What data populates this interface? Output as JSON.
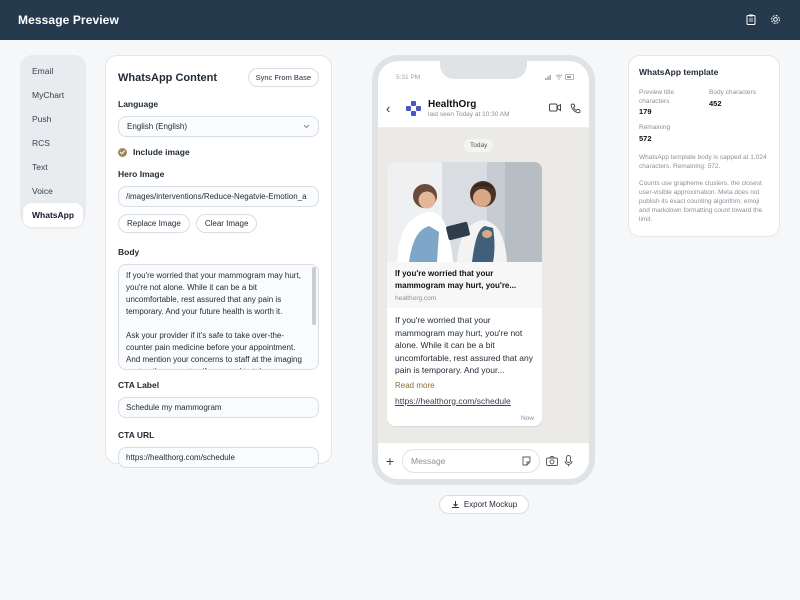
{
  "app": {
    "title": "Message Preview"
  },
  "channels": [
    {
      "label": "Email"
    },
    {
      "label": "MyChart"
    },
    {
      "label": "Push"
    },
    {
      "label": "RCS"
    },
    {
      "label": "Text"
    },
    {
      "label": "Voice"
    },
    {
      "label": "WhatsApp",
      "active": true
    }
  ],
  "content_panel": {
    "title": "WhatsApp Content",
    "sync_label": "Sync From Base",
    "language_label": "Language",
    "language_value": "English (English)",
    "include_image_label": "Include image",
    "hero_label": "Hero Image",
    "hero_value": "/images/interventions/Reduce-Negatvie-Emotion_a",
    "replace_label": "Replace Image",
    "clear_label": "Clear Image",
    "body_label": "Body",
    "body_p1": "If you're worried that your mammogram may hurt, you're not alone. While it can be a bit uncomfortable, rest assured that any pain is temporary. And your future health is worth it.",
    "body_p2": "Ask your provider if it's safe to take over-the-counter pain medicine before your appointment. And mention your concerns to staff at the imaging center; they can stop if you need to take a",
    "cta_label_label": "CTA Label",
    "cta_label_value": "Schedule my mammogram",
    "cta_url_label": "CTA URL",
    "cta_url_value": "https://healthorg.com/schedule"
  },
  "phone": {
    "time": "5:31 PM",
    "contact_name": "HealthOrg",
    "last_seen": "last seen Today at 10:30 AM",
    "date_chip": "Today",
    "link_title": "If you're worried that your mammogram may hurt, you're...",
    "link_domain": "healthorg.com",
    "message": "If you're worried that your mammogram may hurt, you're not alone. While it can be a bit uncomfortable, rest assured that any pain is temporary. And your...",
    "read_more": "Read more",
    "link_url": "https://healthorg.com/schedule",
    "timestamp": "Now",
    "input_placeholder": "Message"
  },
  "export_label": "Export Mockup",
  "info_panel": {
    "title": "WhatsApp template",
    "preview_title_label": "Preview title characters",
    "preview_title_value": "179",
    "body_chars_label": "Body characters",
    "body_chars_value": "452",
    "remaining_label": "Remaining",
    "remaining_value": "572",
    "note1": "WhatsApp template body is capped at 1,024 characters. Remaining: 572.",
    "note2": "Counts use grapheme clusters, the closest user-visible approximation. Meta does not publish its exact counting algorithm; emoji and markdown formatting count toward the limit."
  },
  "colors": {
    "topbar": "#253b4d",
    "accent": "#a0875a",
    "avatar": "#4a56c7"
  },
  "icons": [
    "clipboard-icon",
    "gear-icon",
    "back-arrow-icon",
    "video-icon",
    "phone-icon",
    "plus-icon",
    "sticker-icon",
    "camera-icon",
    "mic-icon",
    "download-icon",
    "chevron-down-icon"
  ]
}
